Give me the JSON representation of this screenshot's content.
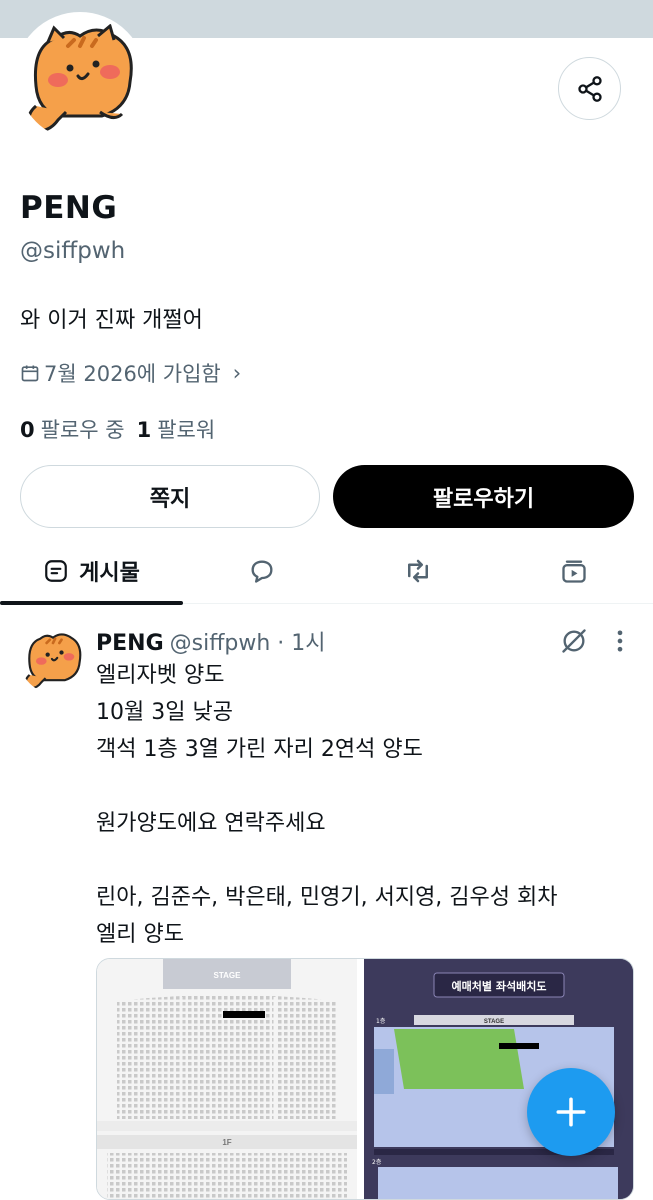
{
  "profile": {
    "name": "PENG",
    "handle": "@siffpwh",
    "bio": "와 이거 진짜 개쩔어",
    "joined": "7월 2026에 가입함",
    "following_count": "0",
    "following_label": "팔로우 중",
    "followers_count": "1",
    "followers_label": "팔로워"
  },
  "actions": {
    "dm_label": "쪽지",
    "follow_label": "팔로우하기"
  },
  "tabs": {
    "posts_label": "게시물"
  },
  "post": {
    "name": "PENG",
    "meta": "@siffpwh · 1시",
    "lines": [
      "엘리자벳 양도",
      "10월 3일 낮공",
      "객석 1층 3열 가린 자리 2연석 양도",
      "",
      "원가양도에요 연락주세요",
      "",
      "린아, 김준수, 박은태, 민영기, 서지영, 김우성 회차",
      "엘리 양도"
    ],
    "image1": {
      "stage_label": "STAGE",
      "floor_label": "1F"
    },
    "image2": {
      "title": "예매처별 좌석배치도",
      "stage_label": "STAGE",
      "floor1_label": "1층",
      "floor2_label": "2층"
    }
  },
  "colors": {
    "accent": "#1d9bf0",
    "text": "#0f1419",
    "muted": "#536471",
    "banner": "#cfd9de"
  },
  "icons": {
    "share": "share-icon",
    "calendar": "calendar-icon",
    "posts_tab": "posts-icon",
    "replies_tab": "reply-icon",
    "reposts_tab": "repost-icon",
    "media_tab": "media-icon",
    "grok": "grok-icon",
    "more": "more-icon",
    "compose": "plus-icon"
  }
}
